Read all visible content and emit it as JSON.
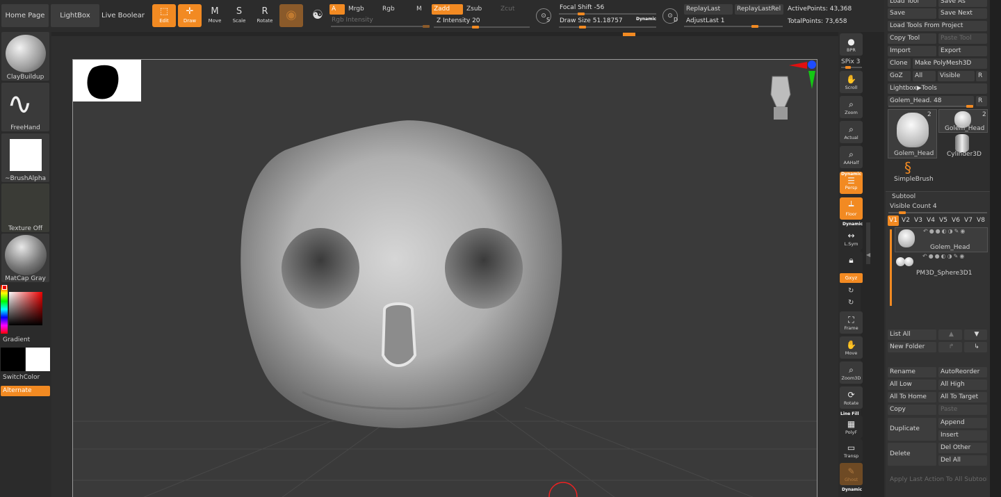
{
  "topbar": {
    "home_page": "Home Page",
    "lightbox": "LightBox",
    "live_boolean": "Live Boolean",
    "edit": "Edit",
    "draw": "Draw",
    "move": "Move",
    "scale": "Scale",
    "rotate": "Rotate",
    "a": "A",
    "mrgb": "Mrgb",
    "rgb": "Rgb",
    "m": "M",
    "zadd": "Zadd",
    "zsub": "Zsub",
    "zcut": "Zcut",
    "rgb_intensity": "Rgb Intensity",
    "z_intensity_label": "Z Intensity",
    "z_intensity_value": "20",
    "focal_shift_label": "Focal Shift",
    "focal_shift_value": "-56",
    "draw_size_label": "Draw Size",
    "draw_size_value": "51.18757",
    "dynamic": "Dynamic",
    "replay_last": "ReplayLast",
    "replay_last_rel": "ReplayLastRel",
    "adjust_last_label": "AdjustLast",
    "adjust_last_value": "1",
    "active_points": "ActivePoints: 43,368",
    "total_points": "TotalPoints: 73,658",
    "s_key": "S",
    "d_key": "D"
  },
  "left_panel": {
    "brush": "ClayBuildup",
    "stroke": "FreeHand",
    "alpha": "~BrushAlpha",
    "texture": "Texture Off",
    "material": "MatCap Gray",
    "gradient": "Gradient",
    "switch_color": "SwitchColor",
    "alternate": "Alternate"
  },
  "shelf": {
    "bpr": "BPR",
    "spix_label": "SPix",
    "spix_value": "3",
    "scroll": "Scroll",
    "zoom": "Zoom",
    "actual": "Actual",
    "aahalf": "AAHalf",
    "dynamic_top": "Dynamic",
    "persp": "Persp",
    "floor": "Floor",
    "dynamic_mid": "Dynamic",
    "lsym": "L.Sym",
    "xyz": "Gxyz",
    "frame": "Frame",
    "move": "Move",
    "zoom3d": "Zoom3D",
    "rotate": "Rotate",
    "line_fill": "Line Fill",
    "polyf": "PolyF",
    "transp": "Transp",
    "ghost": "Ghost",
    "dynamic_bottom": "Dynamic"
  },
  "tool_panel": {
    "load_tool": "Load Tool",
    "save_as": "Save As",
    "save": "Save",
    "save_next": "Save Next",
    "load_from_project": "Load Tools From Project",
    "copy_tool": "Copy Tool",
    "paste_tool": "Paste Tool",
    "import": "Import",
    "export": "Export",
    "clone": "Clone",
    "make_polymesh": "Make PolyMesh3D",
    "goz": "GoZ",
    "all": "All",
    "visible": "Visible",
    "r": "R",
    "lightbox_tools": "Lightbox▶Tools",
    "current_tool_label": "Golem_Head.",
    "current_tool_value": "48",
    "thumbs": [
      {
        "name": "Golem_Head",
        "count": "2"
      },
      {
        "name": "Golem_Head",
        "count": "2"
      },
      {
        "name": "Cylinder3D",
        "count": ""
      },
      {
        "name": "SimpleBrush",
        "count": ""
      }
    ]
  },
  "subtool": {
    "title": "Subtool",
    "visible_count_label": "Visible Count",
    "visible_count_value": "4",
    "views": [
      "V1",
      "V2",
      "V3",
      "V4",
      "V5",
      "V6",
      "V7",
      "V8"
    ],
    "items": [
      "Golem_Head",
      "PM3D_Sphere3D1"
    ],
    "list_all": "List All",
    "new_folder": "New Folder",
    "rename": "Rename",
    "auto_reorder": "AutoReorder",
    "all_low": "All Low",
    "all_high": "All High",
    "all_to_home": "All To Home",
    "all_to_target": "All To Target",
    "copy": "Copy",
    "paste": "Paste",
    "duplicate": "Duplicate",
    "append": "Append",
    "insert": "Insert",
    "delete": "Delete",
    "del_other": "Del Other",
    "del_all": "Del All",
    "apply_last": "Apply Last Action To All Subtools"
  },
  "colors": {
    "accent": "#f28a22",
    "panel": "#2e2e2e",
    "button": "#3d3d3d"
  }
}
